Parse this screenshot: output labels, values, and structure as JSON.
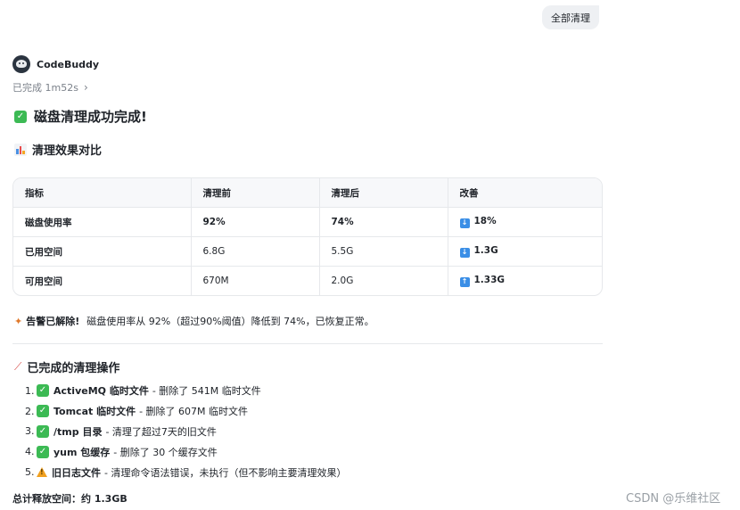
{
  "user_message": "全部清理",
  "agent": {
    "name": "CodeBuddy",
    "status": "已完成 1m52s"
  },
  "title": "磁盘清理成功完成!",
  "section_compare": "清理效果对比",
  "table": {
    "headers": [
      "指标",
      "清理前",
      "清理后",
      "改善"
    ],
    "rows": [
      {
        "metric": "磁盘使用率",
        "before": "92%",
        "after": "74%",
        "change": "18%",
        "direction": "down"
      },
      {
        "metric": "已用空间",
        "before": "6.8G",
        "after": "5.5G",
        "change": "1.3G",
        "direction": "down"
      },
      {
        "metric": "可用空间",
        "before": "670M",
        "after": "2.0G",
        "change": "1.33G",
        "direction": "up"
      }
    ]
  },
  "alert": {
    "label": "告警已解除!",
    "text": "磁盘使用率从 92%（超过90%阈值）降低到 74%，已恢复正常。"
  },
  "section_ops": "已完成的清理操作",
  "operations": [
    {
      "num": "1.",
      "status": "done",
      "name": "ActiveMQ 临时文件",
      "desc": "- 删除了 541M 临时文件"
    },
    {
      "num": "2.",
      "status": "done",
      "name": "Tomcat 临时文件",
      "desc": "- 删除了 607M 临时文件"
    },
    {
      "num": "3.",
      "status": "done",
      "name": "/tmp 目录",
      "desc": "- 清理了超过7天的旧文件"
    },
    {
      "num": "4.",
      "status": "done",
      "name": "yum 包缓存",
      "desc": "- 删除了 30 个缓存文件"
    },
    {
      "num": "5.",
      "status": "warning",
      "name": "旧日志文件",
      "desc": "- 清理命令语法错误，未执行（但不影响主要清理效果）"
    }
  ],
  "total": "总计释放空间：约 1.3GB",
  "watermark": "CSDN @乐维社区",
  "colors": {
    "check": "#3cba54",
    "arrow": "#3a8ee6",
    "warning": "#f0a020"
  }
}
